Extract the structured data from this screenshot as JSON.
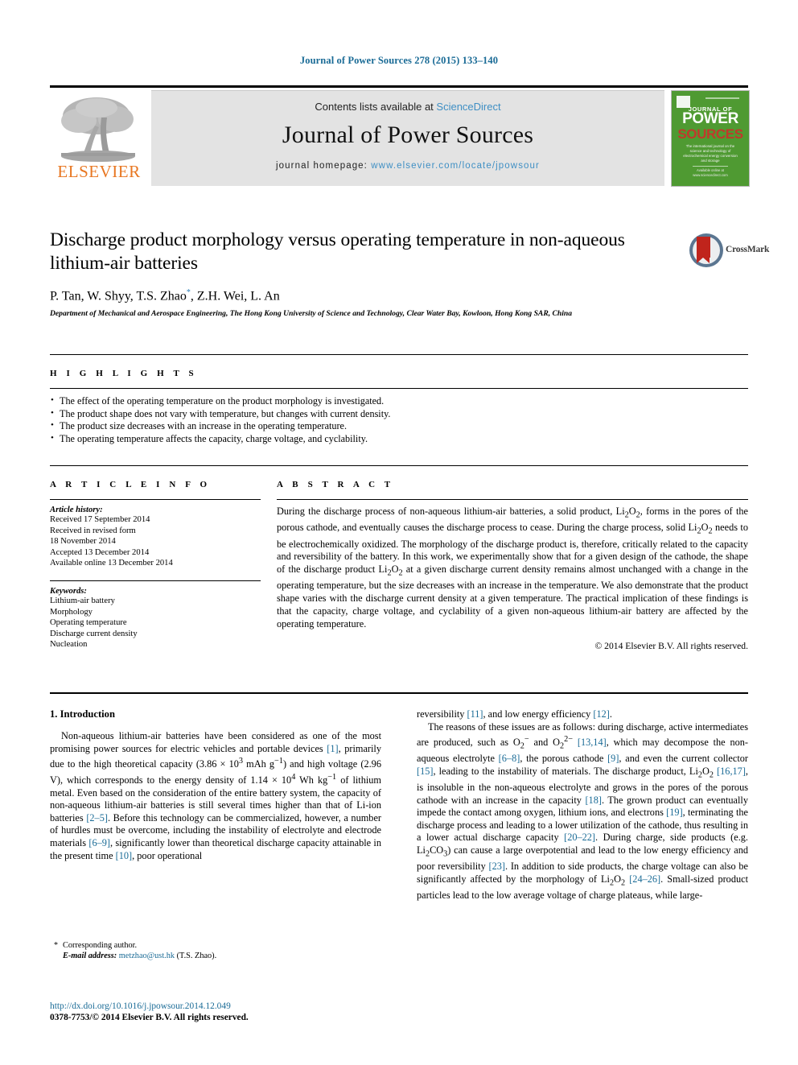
{
  "running_head": "Journal of Power Sources 278 (2015) 133–140",
  "masthead": {
    "contents_prefix": "Contents lists available at ",
    "sciencedirect": "ScienceDirect",
    "journal_name": "Journal of Power Sources",
    "homepage_prefix": "journal homepage: ",
    "homepage_url": "www.elsevier.com/locate/jpowsour",
    "publisher_name": "ELSEVIER",
    "cover": {
      "line1": "JOURNAL OF",
      "line2": "POWER",
      "line3": "SOURCES",
      "blurb": "The international journal on the science and technology of electrochemical energy conversion and storage",
      "footer": "Available online at www.sciencedirect.com"
    }
  },
  "article": {
    "title": "Discharge product morphology versus operating temperature in non-aqueous lithium-air batteries",
    "authors": "P. Tan, W. Shyy, T.S. Zhao, Z.H. Wei, L. An",
    "corresponding_marker": "*",
    "affiliation": "Department of Mechanical and Aerospace Engineering, The Hong Kong University of Science and Technology, Clear Water Bay, Kowloon, Hong Kong SAR, China",
    "crossmark_label": "CrossMark"
  },
  "highlights": {
    "label": "H I G H L I G H T S",
    "items": [
      "The effect of the operating temperature on the product morphology is investigated.",
      "The product shape does not vary with temperature, but changes with current density.",
      "The product size decreases with an increase in the operating temperature.",
      "The operating temperature affects the capacity, charge voltage, and cyclability."
    ]
  },
  "article_info": {
    "label": "A R T I C L E   I N F O",
    "history_heading": "Article history:",
    "history": [
      "Received 17 September 2014",
      "Received in revised form",
      "18 November 2014",
      "Accepted 13 December 2014",
      "Available online 13 December 2014"
    ],
    "keywords_heading": "Keywords:",
    "keywords": [
      "Lithium-air battery",
      "Morphology",
      "Operating temperature",
      "Discharge current density",
      "Nucleation"
    ]
  },
  "abstract": {
    "label": "A B S T R A C T",
    "text_parts": [
      "During the discharge process of non-aqueous lithium-air batteries, a solid product, Li",
      "2",
      "O",
      "2",
      ", forms in the pores of the porous cathode, and eventually causes the discharge process to cease. During the charge process, solid Li",
      "2",
      "O",
      "2",
      " needs to be electrochemically oxidized. The morphology of the discharge product is, therefore, critically related to the capacity and reversibility of the battery. In this work, we experimentally show that for a given design of the cathode, the shape of the discharge product Li",
      "2",
      "O",
      "2",
      " at a given discharge current density remains almost unchanged with a change in the operating temperature, but the size decreases with an increase in the temperature. We also demonstrate that the product shape varies with the discharge current density at a given temperature. The practical implication of these findings is that the capacity, charge voltage, and cyclability of a given non-aqueous lithium-air battery are affected by the operating temperature."
    ],
    "copyright": "© 2014 Elsevier B.V. All rights reserved."
  },
  "introduction": {
    "heading": "1.  Introduction",
    "left_para_1_a": "Non-aqueous lithium-air batteries have been considered as one of the most promising power sources for electric vehicles and portable devices ",
    "cite_1": "[1]",
    "left_para_1_b": ", primarily due to the high theoretical capacity (3.86 × 10",
    "exp_3": "3",
    "left_para_1_c": " mAh g",
    "exp_m1": "−1",
    "left_para_1_d": ") and high voltage (2.96 V), which corresponds to the energy density of 1.14 × 10",
    "exp_4": "4",
    "left_para_1_e": " Wh kg",
    "exp_m1b": "−1",
    "left_para_1_f": " of lithium metal. Even based on the consideration of the entire battery system, the capacity of non-aqueous lithium-air batteries is still several times higher than that of Li-ion batteries ",
    "cite_2_5": "[2–5]",
    "left_para_1_g": ". Before this technology can be commercialized, however, a number of hurdles must be overcome, including the instability of electrolyte and electrode materials ",
    "cite_6_9": "[6–9]",
    "left_para_1_h": ", significantly lower than theoretical discharge capacity attainable in the present time ",
    "cite_10": "[10]",
    "left_para_1_i": ", poor operational",
    "right_para_1_a": "reversibility ",
    "cite_11": "[11]",
    "right_para_1_b": ", and low energy efficiency ",
    "cite_12": "[12]",
    "right_para_1_c": ".",
    "right_para_2_a": "The reasons of these issues are as follows: during discharge, active intermediates are produced, such as O",
    "sub_2a": "2",
    "sup_minus": "−",
    "right_para_2_b": " and O",
    "sub_2b": "2",
    "sup_2minus": "2−",
    "right_para_2_c": " ",
    "cite_13_14": "[13,14]",
    "right_para_2_d": ", which may decompose the non-aqueous electrolyte ",
    "cite_6_8": "[6–8]",
    "right_para_2_e": ", the porous cathode ",
    "cite_9": "[9]",
    "right_para_2_f": ", and even the current collector ",
    "cite_15": "[15]",
    "right_para_2_g": ", leading to the instability of materials. The discharge product, Li",
    "sub_2c": "2",
    "right_para_2_h": "O",
    "sub_2d": "2",
    "right_para_2_i": " ",
    "cite_16_17": "[16,17]",
    "right_para_2_j": ", is insoluble in the non-aqueous electrolyte and grows in the pores of the porous cathode with an increase in the capacity ",
    "cite_18": "[18]",
    "right_para_2_k": ". The grown product can eventually impede the contact among oxygen, lithium ions, and electrons ",
    "cite_19": "[19]",
    "right_para_2_l": ", terminating the discharge process and leading to a lower utilization of the cathode, thus resulting in a lower actual discharge capacity ",
    "cite_20_22": "[20–22]",
    "right_para_2_m": ". During charge, side products (e.g. Li",
    "sub_2e": "2",
    "right_para_2_n": "CO",
    "sub_3": "3",
    "right_para_2_o": ") can cause a large overpotential and lead to the low energy efficiency and poor reversibility ",
    "cite_23": "[23]",
    "right_para_2_p": ". In addition to side products, the charge voltage can also be significantly affected by the morphology of Li",
    "sub_2f": "2",
    "right_para_2_q": "O",
    "sub_2g": "2",
    "right_para_2_r": " ",
    "cite_24_26": "[24–26]",
    "right_para_2_s": ". Small-sized product particles lead to the low average voltage of charge plateaus, while large-"
  },
  "footnote": {
    "corresponding": "Corresponding author.",
    "email_label": "E-mail address:",
    "email": "metzhao@ust.hk",
    "email_owner": "(T.S. Zhao)."
  },
  "bottom": {
    "doi": "http://dx.doi.org/10.1016/j.jpowsour.2014.12.049",
    "issn": "0378-7753/© 2014 Elsevier B.V. All rights reserved."
  },
  "colors": {
    "link": "#1a6b96",
    "elsevier_orange": "#E87722",
    "cover_green": "#4f9a32",
    "crossmark_red": "#c0241c"
  }
}
